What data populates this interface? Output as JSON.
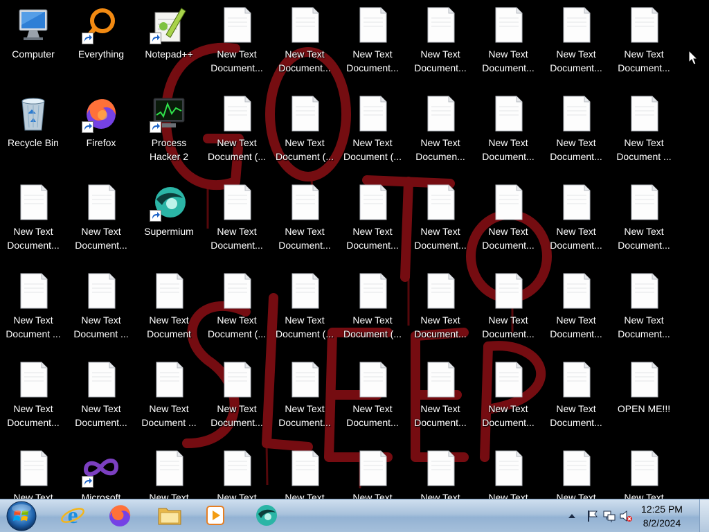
{
  "desktop": {
    "icons": [
      {
        "label": "Computer",
        "icon": "computer-icon",
        "shortcut": false
      },
      {
        "label": "Everything",
        "icon": "everything-search-icon",
        "shortcut": true
      },
      {
        "label": "Notepad++",
        "icon": "notepad-plus-plus-icon",
        "shortcut": true
      },
      {
        "label": "New Text Document...",
        "icon": "text-document-icon",
        "shortcut": false
      },
      {
        "label": "New Text Document...",
        "icon": "text-document-icon",
        "shortcut": false
      },
      {
        "label": "New Text Document...",
        "icon": "text-document-icon",
        "shortcut": false
      },
      {
        "label": "New Text Document...",
        "icon": "text-document-icon",
        "shortcut": false
      },
      {
        "label": "New Text Document...",
        "icon": "text-document-icon",
        "shortcut": false
      },
      {
        "label": "New Text Document...",
        "icon": "text-document-icon",
        "shortcut": false
      },
      {
        "label": "New Text Document...",
        "icon": "text-document-icon",
        "shortcut": false
      },
      {
        "label": "Recycle Bin",
        "icon": "recycle-bin-icon",
        "shortcut": false
      },
      {
        "label": "Firefox",
        "icon": "firefox-icon",
        "shortcut": true
      },
      {
        "label": "Process Hacker 2",
        "icon": "process-hacker-icon",
        "shortcut": true
      },
      {
        "label": "New Text Document (...",
        "icon": "text-document-icon",
        "shortcut": false
      },
      {
        "label": "New Text Document (...",
        "icon": "text-document-icon",
        "shortcut": false
      },
      {
        "label": "New Text Document (...",
        "icon": "text-document-icon",
        "shortcut": false
      },
      {
        "label": "New Text Documen...",
        "icon": "text-document-icon",
        "shortcut": false
      },
      {
        "label": "New Text Document...",
        "icon": "text-document-icon",
        "shortcut": false
      },
      {
        "label": "New Text Document...",
        "icon": "text-document-icon",
        "shortcut": false
      },
      {
        "label": "New Text Document ...",
        "icon": "text-document-icon",
        "shortcut": false
      },
      {
        "label": "New Text Document...",
        "icon": "text-document-icon",
        "shortcut": false
      },
      {
        "label": "New Text Document...",
        "icon": "text-document-icon",
        "shortcut": false
      },
      {
        "label": "Supermium",
        "icon": "supermium-icon",
        "shortcut": true
      },
      {
        "label": "New Text Document...",
        "icon": "text-document-icon",
        "shortcut": false
      },
      {
        "label": "New Text Document...",
        "icon": "text-document-icon",
        "shortcut": false
      },
      {
        "label": "New Text Document...",
        "icon": "text-document-icon",
        "shortcut": false
      },
      {
        "label": "New Text Document...",
        "icon": "text-document-icon",
        "shortcut": false
      },
      {
        "label": "New Text Document...",
        "icon": "text-document-icon",
        "shortcut": false
      },
      {
        "label": "New Text Document...",
        "icon": "text-document-icon",
        "shortcut": false
      },
      {
        "label": "New Text Document...",
        "icon": "text-document-icon",
        "shortcut": false
      },
      {
        "label": "New Text Document ...",
        "icon": "text-document-icon",
        "shortcut": false
      },
      {
        "label": "New Text Document ...",
        "icon": "text-document-icon",
        "shortcut": false
      },
      {
        "label": "New Text Document",
        "icon": "text-document-icon",
        "shortcut": false
      },
      {
        "label": "New Text Document (...",
        "icon": "text-document-icon",
        "shortcut": false
      },
      {
        "label": "New Text Document (...",
        "icon": "text-document-icon",
        "shortcut": false
      },
      {
        "label": "New Text Document (...",
        "icon": "text-document-icon",
        "shortcut": false
      },
      {
        "label": "New Text Document...",
        "icon": "text-document-icon",
        "shortcut": false
      },
      {
        "label": "New Text Document...",
        "icon": "text-document-icon",
        "shortcut": false
      },
      {
        "label": "New Text Document...",
        "icon": "text-document-icon",
        "shortcut": false
      },
      {
        "label": "New Text Document...",
        "icon": "text-document-icon",
        "shortcut": false
      },
      {
        "label": "New Text Document...",
        "icon": "text-document-icon",
        "shortcut": false
      },
      {
        "label": "New Text Document...",
        "icon": "text-document-icon",
        "shortcut": false
      },
      {
        "label": "New Text Document ...",
        "icon": "text-document-icon",
        "shortcut": false
      },
      {
        "label": "New Text Document...",
        "icon": "text-document-icon",
        "shortcut": false
      },
      {
        "label": "New Text Document...",
        "icon": "text-document-icon",
        "shortcut": false
      },
      {
        "label": "New Text Document...",
        "icon": "text-document-icon",
        "shortcut": false
      },
      {
        "label": "New Text Document...",
        "icon": "text-document-icon",
        "shortcut": false
      },
      {
        "label": "New Text Document...",
        "icon": "text-document-icon",
        "shortcut": false
      },
      {
        "label": "New Text Document...",
        "icon": "text-document-icon",
        "shortcut": false
      },
      {
        "label": "OPEN ME!!!",
        "icon": "text-document-icon",
        "shortcut": false
      },
      {
        "label": "New Text",
        "icon": "text-document-icon",
        "shortcut": false
      },
      {
        "label": "Microsoft",
        "icon": "visual-studio-icon",
        "shortcut": true
      },
      {
        "label": "New Text",
        "icon": "text-document-icon",
        "shortcut": false
      },
      {
        "label": "New Text",
        "icon": "text-document-icon",
        "shortcut": false
      },
      {
        "label": "New Text",
        "icon": "text-document-icon",
        "shortcut": false
      },
      {
        "label": "New Text",
        "icon": "text-document-icon",
        "shortcut": false
      },
      {
        "label": "New Text",
        "icon": "text-document-icon",
        "shortcut": false
      },
      {
        "label": "New Text",
        "icon": "text-document-icon",
        "shortcut": false
      },
      {
        "label": "New Text",
        "icon": "text-document-icon",
        "shortcut": false
      },
      {
        "label": "New Text",
        "icon": "text-document-icon",
        "shortcut": false
      }
    ]
  },
  "taskbar": {
    "start_icon": "windows-start-orb-icon",
    "pinned": [
      {
        "name": "internet-explorer",
        "icon": "internet-explorer-icon"
      },
      {
        "name": "firefox",
        "icon": "firefox-icon"
      },
      {
        "name": "file-explorer",
        "icon": "folder-icon"
      },
      {
        "name": "media-player",
        "icon": "media-player-icon"
      },
      {
        "name": "supermium",
        "icon": "supermium-icon"
      }
    ],
    "tray": {
      "icons": [
        "show-hidden-icons-chevron",
        "action-center-flag-icon",
        "network-icon",
        "volume-muted-icon"
      ],
      "time": "12:25 PM",
      "date": "8/2/2024"
    }
  },
  "colors": {
    "wallpaper_bg": "#000000",
    "wallpaper_paint": "#8a0f14",
    "taskbar_top": "#cfdfef",
    "taskbar_bottom": "#93b2d3"
  }
}
